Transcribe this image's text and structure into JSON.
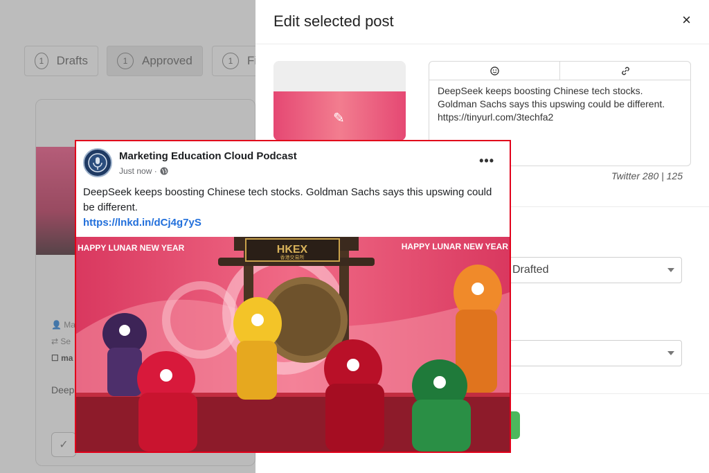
{
  "background": {
    "tabs": [
      {
        "num": "1",
        "label": "Drafts"
      },
      {
        "num": "1",
        "label": "Approved"
      },
      {
        "num": "1",
        "label": "Fir"
      }
    ],
    "card": {
      "meta1": "Ma",
      "meta2": "Se",
      "meta3": "ma",
      "text": "Deep"
    }
  },
  "panel": {
    "title": "Edit selected post",
    "close_label": "×",
    "editor": {
      "tool1_icon": "emoji-icon",
      "tool2_icon": "link-icon",
      "lines": [
        "DeepSeek keeps boosting Chinese tech stocks.",
        "Goldman Sachs says this upswing could be different.",
        "https://tinyurl.com/3techfa2"
      ]
    },
    "counter": "Twitter 280  |  125",
    "status_select": "Drafted",
    "second_select": ""
  },
  "preview": {
    "page_name": "Marketing Education Cloud Podcast",
    "time": "Just now ·",
    "text": "DeepSeek keeps boosting Chinese tech stocks. Goldman Sachs says this upswing could be different.",
    "link": "https://lnkd.in/dCj4g7yS",
    "image": {
      "banner_left": "HAPPY LUNAR NEW YEAR",
      "banner_right": "HAPPY LUNAR NEW YEAR",
      "sign": "HKEX",
      "sign_sub": "香港交易所"
    }
  },
  "colors": {
    "accent_red": "#e1001a",
    "link_blue": "#216fdb",
    "green": "#4cb85c"
  }
}
